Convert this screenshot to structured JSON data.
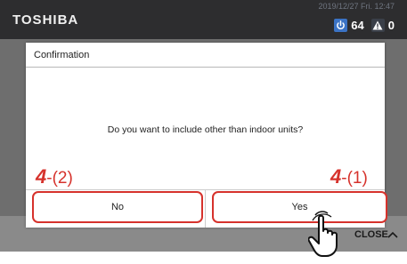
{
  "header": {
    "brand": "TOSHIBA",
    "datetime": "2019/12/27 Fri. 12:47",
    "power_count": "64",
    "alarm_count": "0"
  },
  "footer": {
    "close_label": "CLOSE"
  },
  "dialog": {
    "title": "Confirmation",
    "message": "Do you want to include other than indoor units?",
    "no_label": "No",
    "yes_label": "Yes"
  },
  "annotations": {
    "left_step": "4",
    "left_sub": "-(2)",
    "right_step": "4",
    "right_sub": "-(1)"
  },
  "colors": {
    "highlight": "#d6322c",
    "topbar": "#2d2d2f",
    "power_badge": "#3b73c5"
  },
  "icons": [
    "power-icon",
    "warning-icon",
    "chevron-up-icon",
    "hand-pointer-icon"
  ]
}
